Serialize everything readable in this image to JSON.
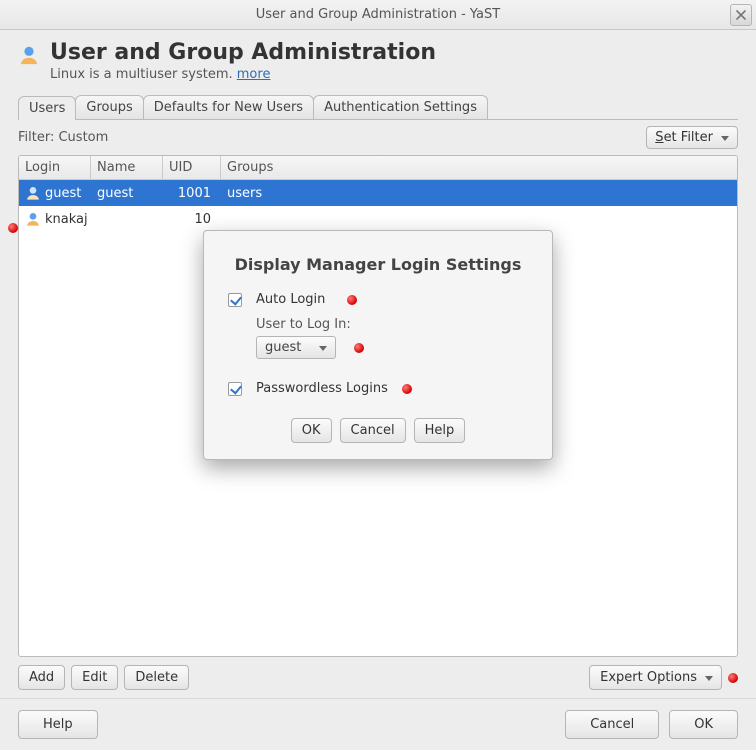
{
  "window": {
    "title": "User and Group Administration - YaST"
  },
  "header": {
    "title": "User and Group Administration",
    "subtitle": "Linux is a multiuser system.",
    "more_link": "more"
  },
  "tabs": [
    "Users",
    "Groups",
    "Defaults for New Users",
    "Authentication Settings"
  ],
  "filter": {
    "label": "Filter: Custom",
    "set_filter_prefix": "S",
    "set_filter_rest": "et Filter"
  },
  "columns": {
    "login": "Login",
    "name": "Name",
    "uid": "UID",
    "groups": "Groups"
  },
  "rows": [
    {
      "login": "guest",
      "name": "guest",
      "uid": "1001",
      "groups": "users",
      "selected": true
    },
    {
      "login": "knakaj",
      "name": "",
      "uid": "10",
      "groups": "",
      "selected": false
    }
  ],
  "row_buttons": {
    "add": "Add",
    "edit": "Edit",
    "delete": "Delete",
    "expert": "Expert Options"
  },
  "footer": {
    "help": "Help",
    "cancel": "Cancel",
    "ok": "OK"
  },
  "modal": {
    "title": "Display Manager Login Settings",
    "auto_login": "Auto Login",
    "user_to_login": "User to Log In:",
    "selected_user": "guest",
    "passwordless": "Passwordless Logins",
    "ok": "OK",
    "cancel": "Cancel",
    "help": "Help"
  }
}
